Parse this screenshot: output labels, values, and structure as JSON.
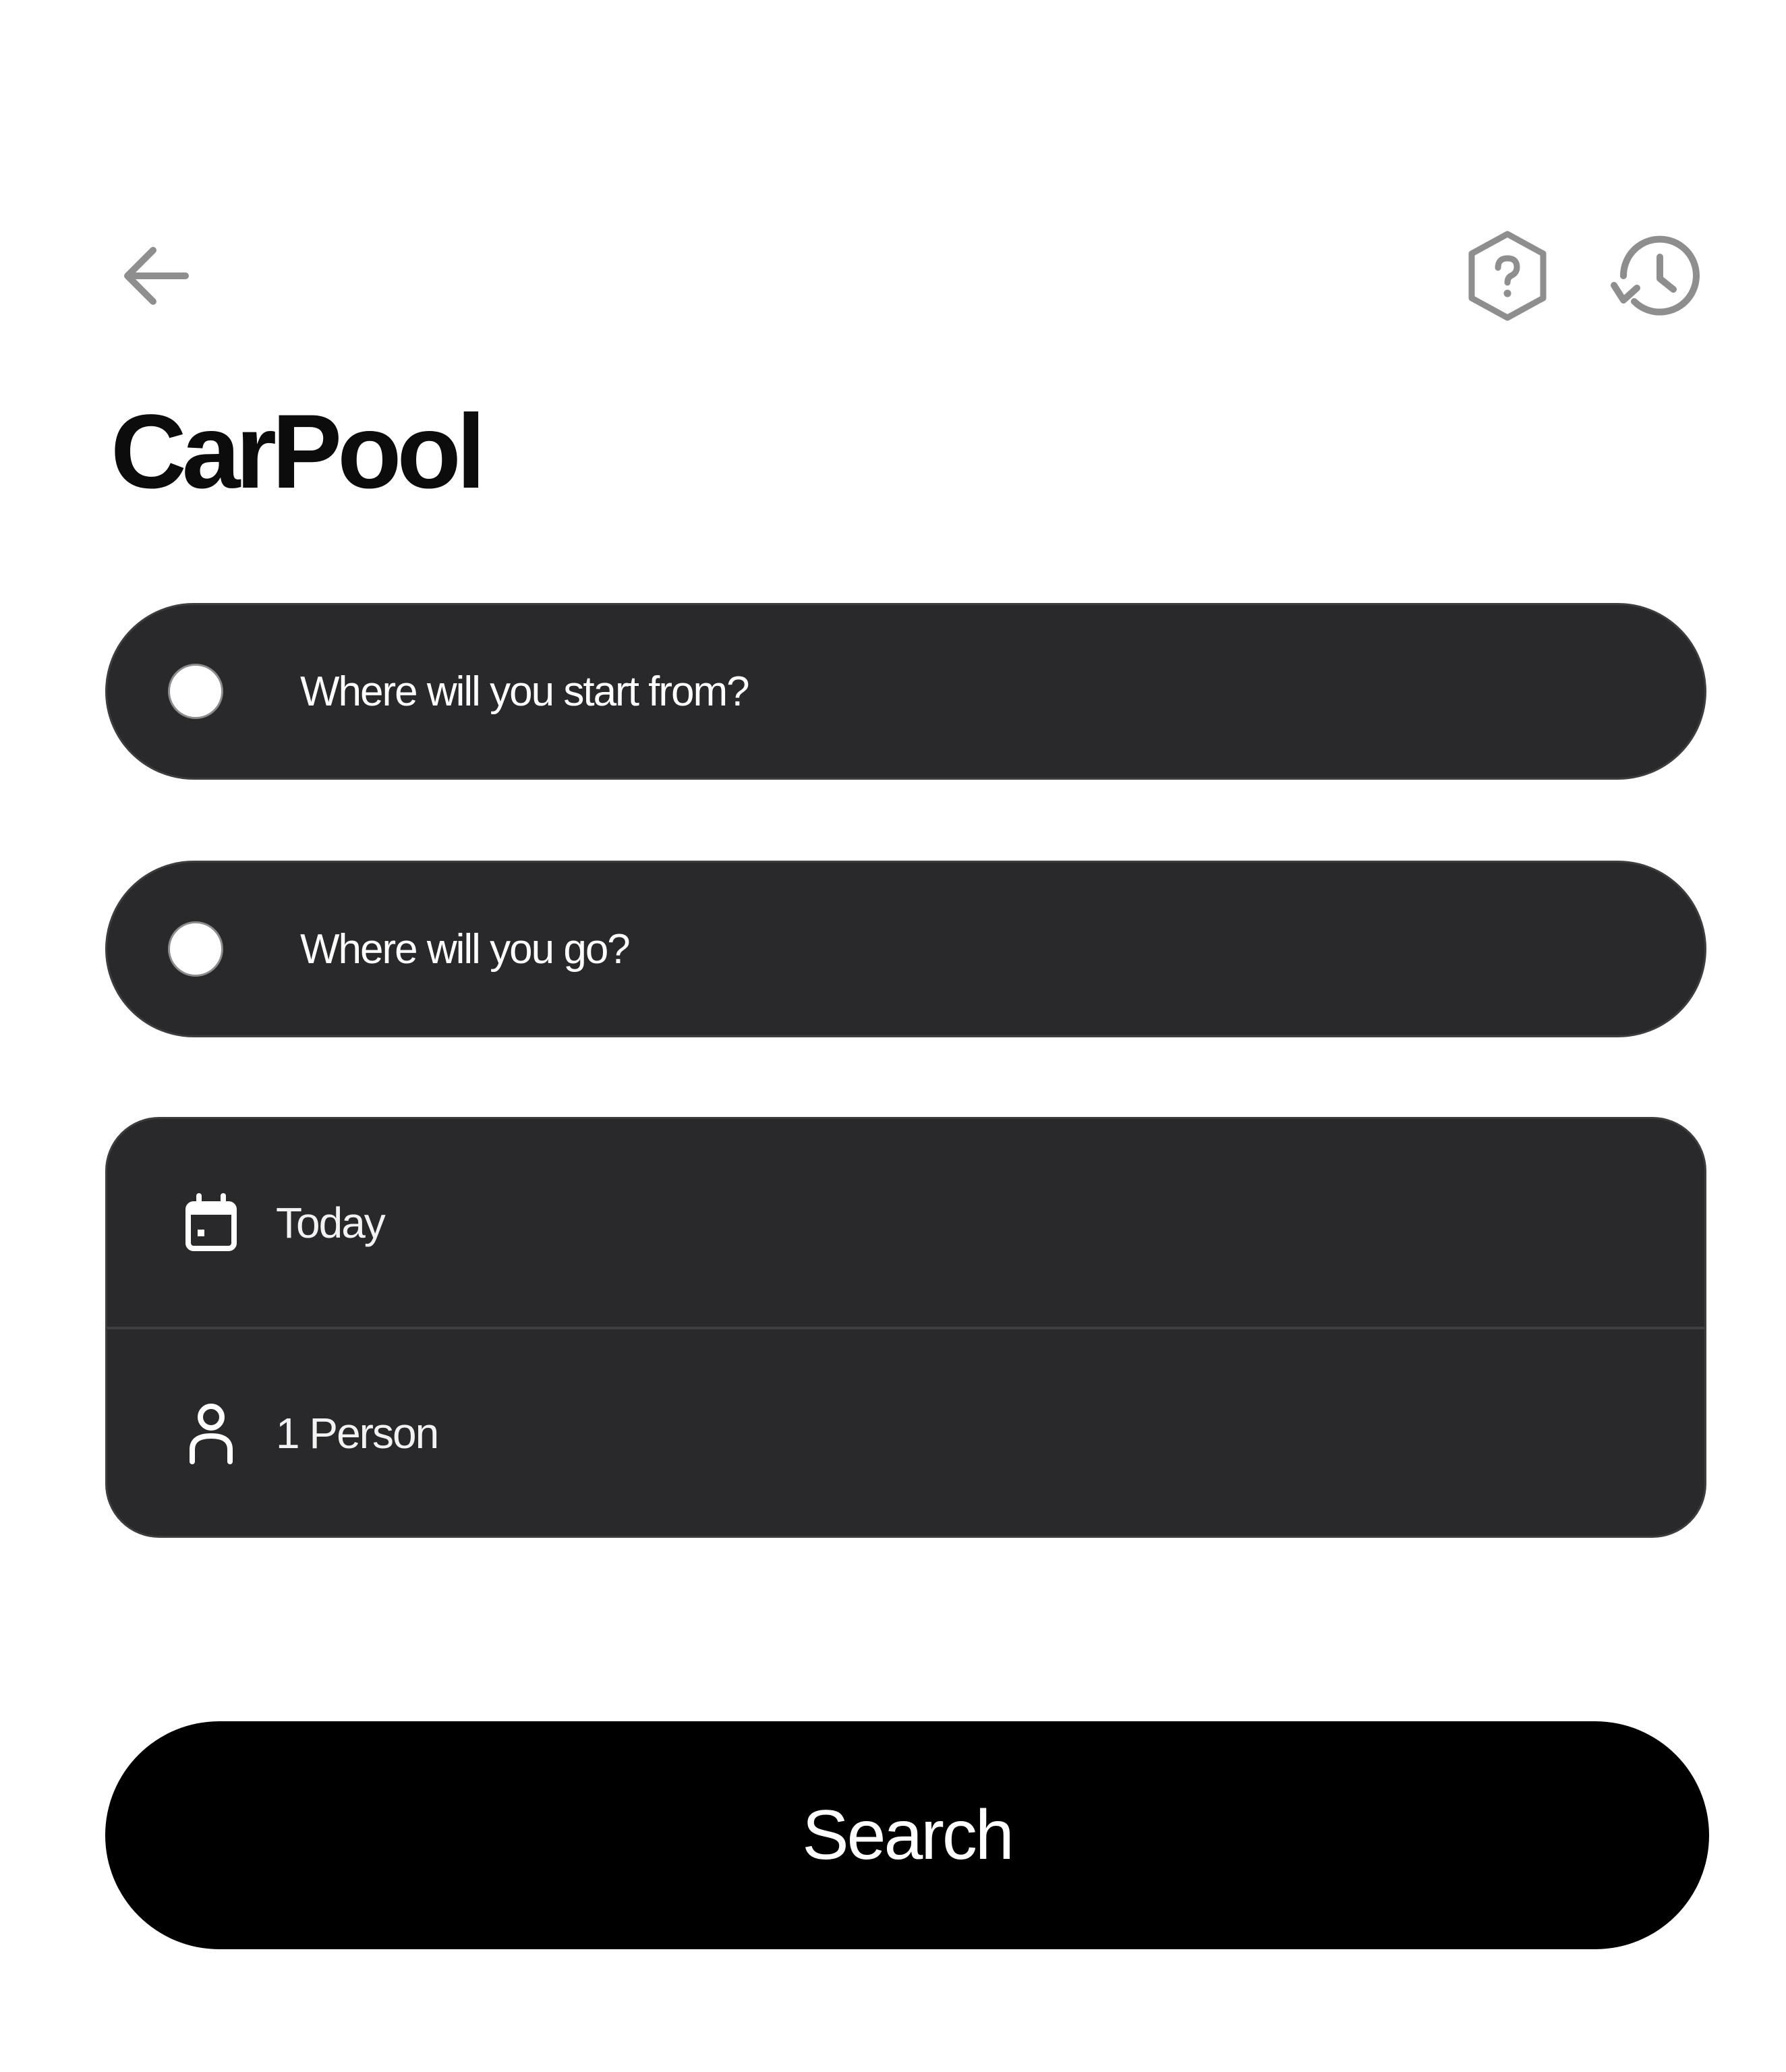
{
  "header": {
    "back_icon": "arrow-left-icon",
    "help_icon": "hexagon-question-icon",
    "history_icon": "history-clock-icon",
    "icon_color": "#8e8e8e"
  },
  "page": {
    "title": "CarPool"
  },
  "route": {
    "from_placeholder": "Where will you start from?",
    "to_placeholder": "Where will you go?"
  },
  "options": {
    "date_icon": "calendar-icon",
    "date_label": "Today",
    "people_icon": "person-icon",
    "people_label": "1 Person"
  },
  "actions": {
    "search_label": "Search"
  },
  "colors": {
    "background": "#ffffff",
    "field_background": "#29292b",
    "primary_button": "#000000",
    "text_on_dark": "#ffffff"
  }
}
